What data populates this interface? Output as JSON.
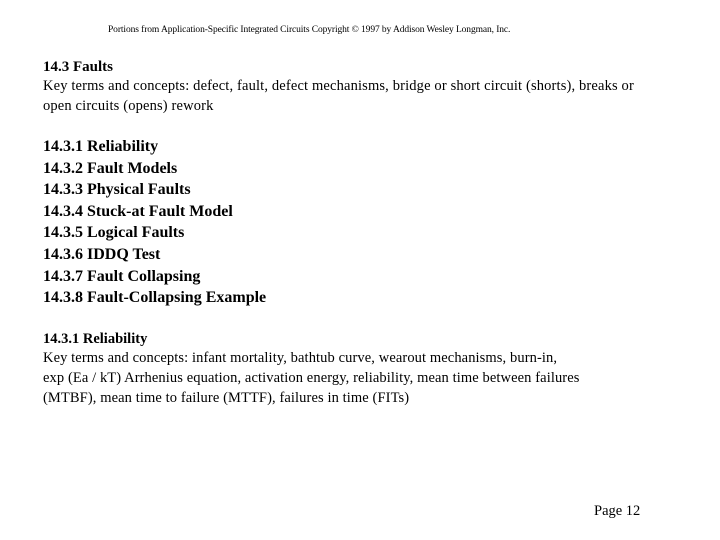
{
  "header": {
    "copyright": "Portions from Application-Specific Integrated Circuits Copyright © 1997 by Addison Wesley Longman, Inc."
  },
  "intro": {
    "heading": "14.3 Faults",
    "text_lines": [
      "Key terms and concepts: defect, fault, defect mechanisms, bridge or short circuit (shorts), breaks or",
      "open circuits (opens) rework"
    ]
  },
  "toc": {
    "items": [
      "14.3.1 Reliability",
      "14.3.2 Fault Models",
      "14.3.3 Physical Faults",
      "14.3.4 Stuck-at Fault Model",
      "14.3.5 Logical Faults",
      "14.3.6 IDDQ Test",
      "14.3.7 Fault Collapsing",
      "14.3.8 Fault-Collapsing Example"
    ]
  },
  "reliability": {
    "heading": "14.3.1 Reliability",
    "text_lines": [
      "Key terms and concepts: infant mortality, bathtub curve, wearout mechanisms, burn-in,",
      "exp (Ea / kT) Arrhenius equation, activation energy, reliability, mean time between failures",
      "(MTBF), mean time to failure (MTTF), failures in time (FITs)"
    ]
  },
  "footer": {
    "page_label": "Page 12"
  }
}
